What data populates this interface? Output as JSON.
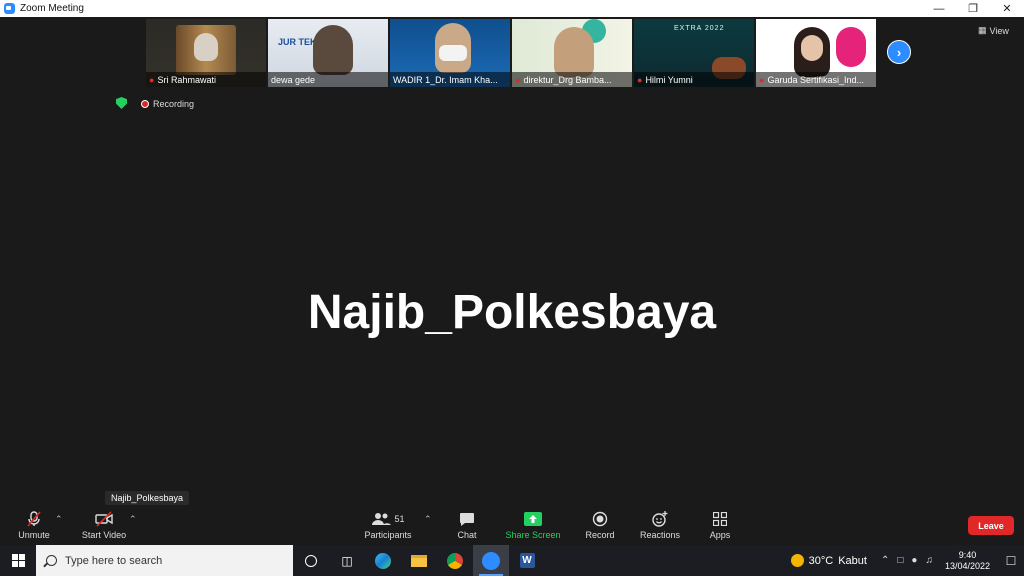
{
  "window": {
    "title": "Zoom Meeting"
  },
  "participants_strip": [
    {
      "name": "Sri Rahmawati",
      "muted": true
    },
    {
      "name": "dewa gede",
      "muted": false
    },
    {
      "name": "WADIR 1_Dr. Imam Kha...",
      "muted": false
    },
    {
      "name": "direktur_Drg Bamba...",
      "muted": true
    },
    {
      "name": "Hilmi Yumni",
      "muted": true
    },
    {
      "name": "Garuda Sertifikasi_Ind...",
      "muted": true
    }
  ],
  "tile_text": {
    "t2_banner": "JUR TEKNIK E",
    "t5_label": "EXTRA 2022"
  },
  "view_label": "View",
  "recording_label": "Recording",
  "active_speaker": "Najib_Polkesbaya",
  "tooltip": "Najib_Polkesbaya",
  "controls": {
    "unmute": "Unmute",
    "start_video": "Start Video",
    "participants": "Participants",
    "participants_count": "51",
    "chat": "Chat",
    "share_screen": "Share Screen",
    "record": "Record",
    "reactions": "Reactions",
    "apps": "Apps",
    "leave": "Leave"
  },
  "taskbar": {
    "search_placeholder": "Type here to search",
    "weather_temp": "30°C",
    "weather_desc": "Kabut",
    "time": "9:40",
    "date": "13/04/2022"
  },
  "colors": {
    "accent": "#2D8CFF",
    "share_green": "#23d160",
    "leave_red": "#e02828"
  }
}
